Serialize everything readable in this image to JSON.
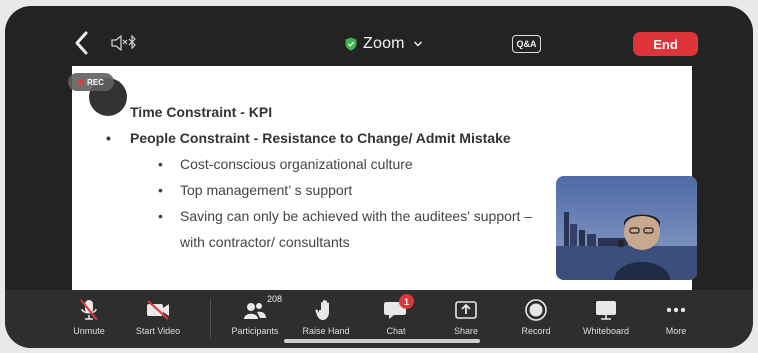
{
  "topbar": {
    "title": "Zoom",
    "qa_label": "Q&A",
    "end_label": "End"
  },
  "recording": {
    "label": "REC"
  },
  "slide": {
    "bullets": [
      "Time Constraint - KPI",
      "People Constraint - Resistance to Change/ Admit Mistake"
    ],
    "sub_bullets": [
      "Cost-conscious organizational culture",
      "Top management’ s support",
      "Saving can only be achieved with the auditees' support –"
    ],
    "continuation": "with contractor/ consultants"
  },
  "toolbar": {
    "unmute": "Unmute",
    "start_video": "Start Video",
    "participants": "Participants",
    "participants_count": "208",
    "raise_hand": "Raise Hand",
    "chat": "Chat",
    "chat_badge": "1",
    "share": "Share",
    "record": "Record",
    "whiteboard": "Whiteboard",
    "more": "More"
  },
  "colors": {
    "end": "#e0343b",
    "shield": "#3fb34f",
    "background": "#232323",
    "toolbar": "#2e2e2e"
  },
  "icons": [
    "back-chevron-icon",
    "speaker-muted-icon",
    "bluetooth-icon",
    "shield-icon",
    "chevron-down-icon",
    "mic-muted-icon",
    "video-off-icon",
    "participants-icon",
    "hand-icon",
    "chat-icon",
    "share-icon",
    "record-icon",
    "whiteboard-icon",
    "more-icon"
  ]
}
